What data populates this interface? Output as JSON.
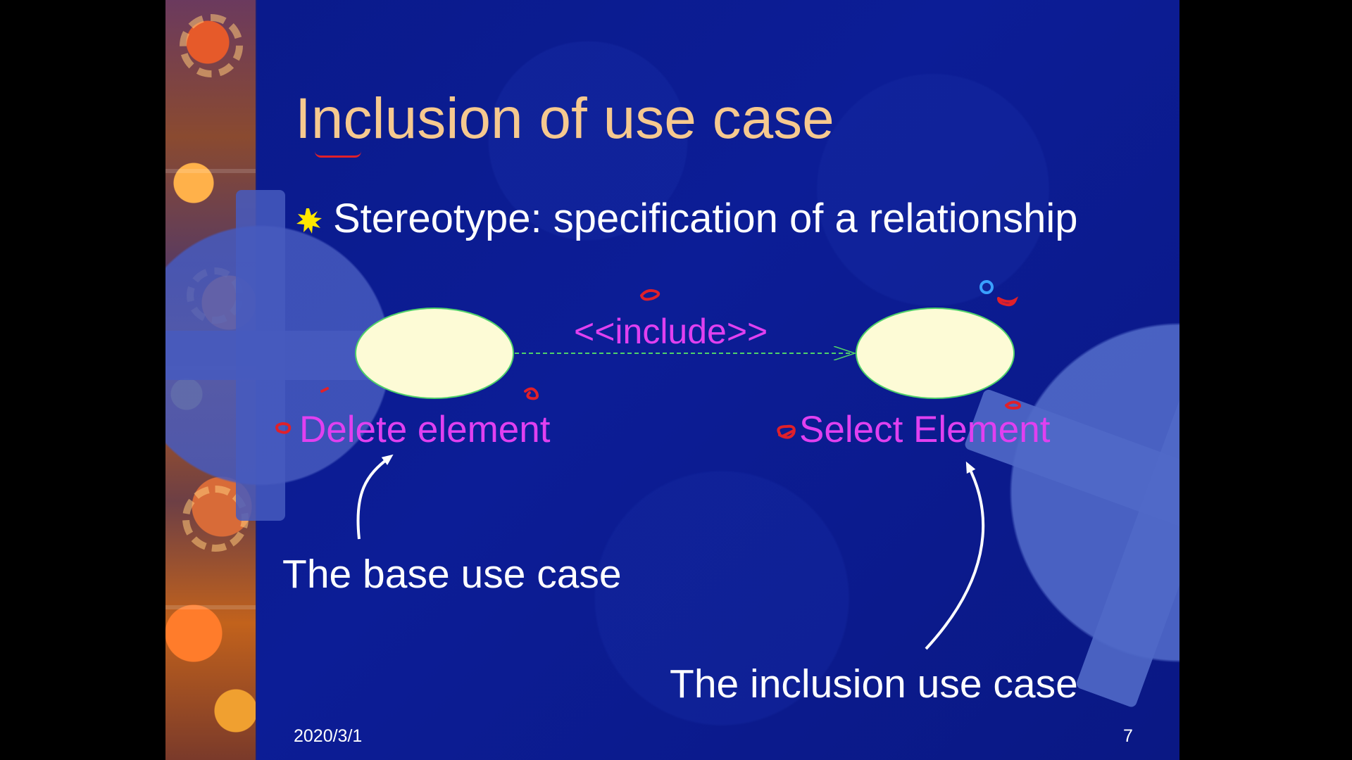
{
  "slide": {
    "title": "Inclusion of use case",
    "bullet": "Stereotype: specification of a relationship",
    "footer": {
      "date": "2020/3/1",
      "page_number": "7"
    }
  },
  "diagram": {
    "relationship_label": "<<include>>",
    "base_use_case": {
      "name": "Delete element",
      "caption": "The base use case"
    },
    "inclusion_use_case": {
      "name": "Select Element",
      "caption": "The inclusion use case"
    }
  },
  "colors": {
    "background": "#0c1d96",
    "title": "#f6c98f",
    "body_text": "#ffffff",
    "diagram_text": "#e040f0",
    "use_case_fill": "#fdfbd6",
    "arrow_line": "#4fd06a",
    "annotation_ink": "#e0202a"
  }
}
